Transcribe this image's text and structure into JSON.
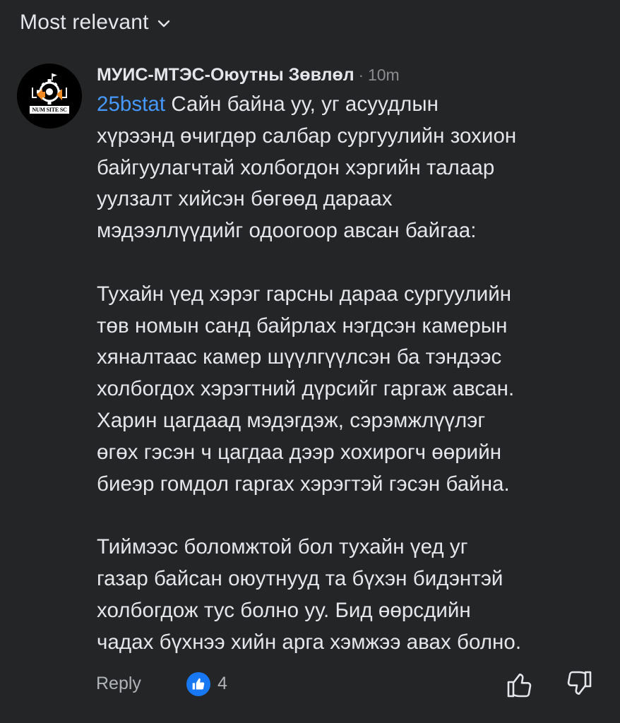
{
  "sort": {
    "label": "Most relevant",
    "icon": "chevron-down-icon"
  },
  "comment": {
    "author": "МУИС-МТЭС-Оюутны Зөвлөл",
    "separator": "·",
    "time": "10m",
    "avatar_text": "NUM SITE SC",
    "mention": "25bstat",
    "paragraph1_lines": [
      " Сайн байна уу, уг асуудлын",
      "хүрээнд өчигдөр салбар сургуулийн зохион",
      "байгуулагчтай холбогдон хэргийн талаар",
      "уулзалт хийсэн бөгөөд дараах",
      "мэдээллүүдийг одоогоор авсан байгаа:"
    ],
    "paragraph2_lines": [
      "Тухайн үед хэрэг гарсны дараа сургуулийн",
      "төв номын санд байрлах нэгдсэн камерын",
      "хяналтаас камер шүүлгүүлсэн ба тэндээс",
      "холбогдох хэрэгтний дүрсийг гаргаж авсан.",
      "Харин цагдаад мэдэгдэж, сэрэмжлүүлэг",
      "өгөх гэсэн ч цагдаа дээр хохирогч өөрийн",
      "биеэр гомдол гаргах хэрэгтэй гэсэн байна."
    ],
    "paragraph3_lines": [
      "Тиймээс боломжтой бол тухайн үед уг",
      "газар байсан оюутнууд та бүхэн бидэнтэй",
      "холбогдож тус болно уу. Бид өөрсдийн",
      "чадах бүхнээ хийн арга хэмжээ авах болно."
    ]
  },
  "actions": {
    "reply_label": "Reply",
    "like_count": "4",
    "like_badge_icon": "like-badge-icon",
    "upvote_icon": "thumbs-up-icon",
    "downvote_icon": "thumbs-down-icon"
  },
  "colors": {
    "background": "#242526",
    "text": "#e4e6eb",
    "secondary_text": "#8a8d91",
    "mention": "#4599ff",
    "like_blue": "#1877f2"
  }
}
